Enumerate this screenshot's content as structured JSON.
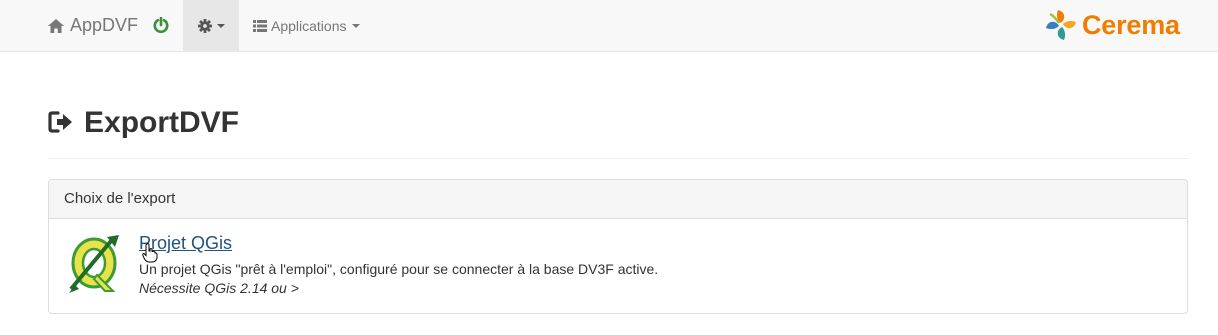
{
  "navbar": {
    "brand_label": "AppDVF",
    "power_icon": "power-icon",
    "settings_icon": "gear-icon",
    "applications_label": "Applications",
    "logo_text": "Cerema",
    "colors": {
      "power": "#3c8f3c",
      "logo_orange": "#f07d00"
    }
  },
  "page": {
    "title": "ExportDVF",
    "title_icon": "sign-out-icon"
  },
  "panel": {
    "heading": "Choix de l'export",
    "item": {
      "title": "Projet QGis",
      "description": "Un projet QGis \"prêt à l'emploi\", configuré pour se connecter à la base DV3F active.",
      "note": "Nécessite QGis 2.14 ou >",
      "icon": "qgis-logo"
    }
  }
}
